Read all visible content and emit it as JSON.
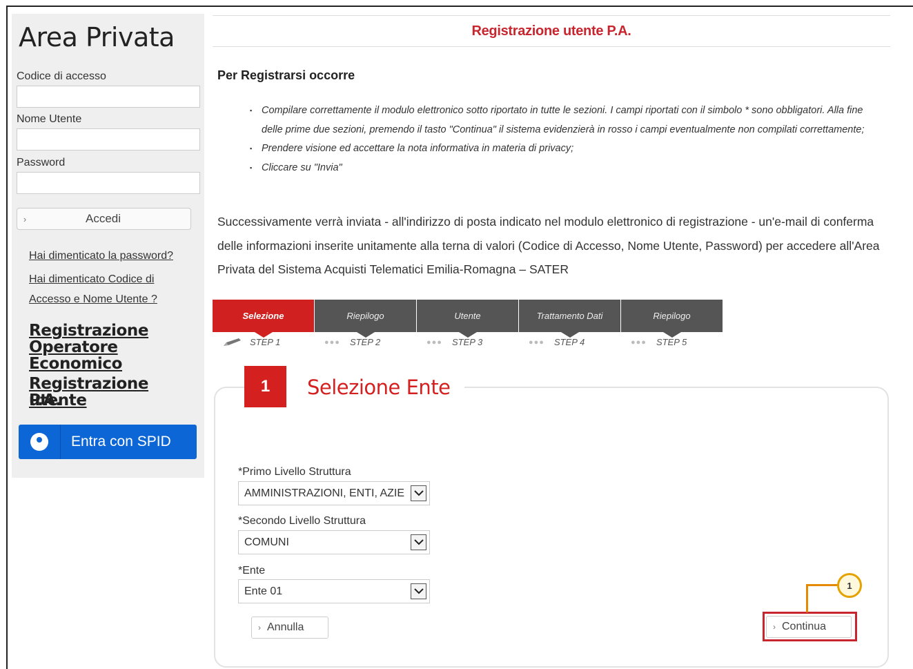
{
  "sidebar": {
    "title": "Area Privata",
    "access_code_label": "Codice di accesso",
    "username_label": "Nome Utente",
    "password_label": "Password",
    "login_button": "Accedi",
    "forgot_password": "Hai dimenticato la password?",
    "forgot_code_line1": "Hai dimenticato Codice di",
    "forgot_code_line2": "Accesso e Nome Utente ?",
    "reg_operator_line1": "Registrazione",
    "reg_operator_line2": "Operatore Economico",
    "reg_pa_line1": "Registrazione utente",
    "reg_pa_line2": "P.A.",
    "spid_button": "Entra con SPID"
  },
  "main": {
    "page_title": "Registrazione utente P.A.",
    "subheading": "Per Registrarsi occorre",
    "bullets": [
      "Compilare correttamente il modulo elettronico sotto riportato in tutte le sezioni. I campi riportati con il simbolo * sono obbligatori. Alla fine delle prime due sezioni, premendo il tasto \"Continua\" il sistema evidenzierà in rosso i campi eventualmente non compilati correttamente;",
      "Prendere visione ed accettare la nota informativa in materia di privacy;",
      "Cliccare su \"Invia\""
    ],
    "paragraph": "Successivamente verrà inviata - all'indirizzo di posta indicato nel modulo elettronico di registrazione - un'e-mail di conferma delle informazioni inserite unitamente alla terna di valori (Codice di Accesso, Nome Utente, Password) per accedere all'Area Privata del Sistema Acquisti Telematici Emilia-Romagna – SATER"
  },
  "steps": [
    {
      "label": "Selezione",
      "sub": "STEP 1"
    },
    {
      "label": "Riepilogo",
      "sub": "STEP 2"
    },
    {
      "label": "Utente",
      "sub": "STEP 3"
    },
    {
      "label": "Trattamento Dati",
      "sub": "STEP 4"
    },
    {
      "label": "Riepilogo",
      "sub": "STEP 5"
    }
  ],
  "form": {
    "section_number": "1",
    "section_title": "Selezione Ente",
    "first_level_label": "*Primo Livello Struttura",
    "first_level_value": "AMMINISTRAZIONI, ENTI, AZIE",
    "second_level_label": "*Secondo Livello Struttura",
    "second_level_value": "COMUNI",
    "entity_label": "*Ente",
    "entity_value": "Ente 01",
    "cancel_button": "Annulla",
    "continue_button": "Continua",
    "callout_number": "1"
  },
  "colors": {
    "accent_red": "#d52020",
    "spid_blue": "#0d66d6",
    "callout_orange": "#e58a00",
    "step_gray": "#555555"
  }
}
